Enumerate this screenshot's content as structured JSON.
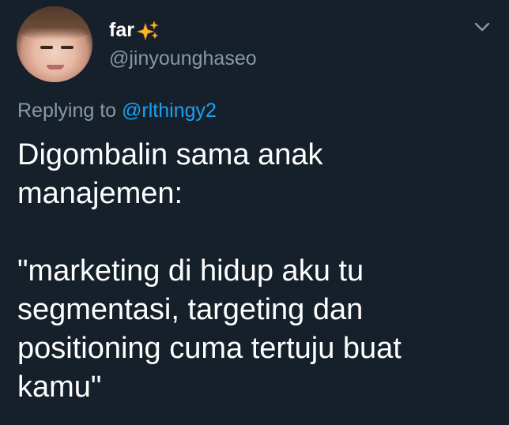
{
  "author": {
    "display_name": "far",
    "handle": "@jinyounghaseo",
    "badge_icon": "sparkles-icon",
    "avatar_icon": "avatar-photo"
  },
  "menu": {
    "icon": "chevron-down-icon",
    "color": "#8899a6"
  },
  "reply": {
    "prefix": "Replying to ",
    "mention": "@rlthingy2"
  },
  "tweet": {
    "text": "Digombalin sama anak\nmanajemen:\n\n\"marketing di hidup aku tu\nsegmentasi, targeting dan\npositioning cuma tertuju buat\nkamu\""
  },
  "colors": {
    "background": "#15202b",
    "text": "#ffffff",
    "secondary_text": "#8899a6",
    "link": "#1da1f2",
    "sparkle": "#f5b82e"
  }
}
